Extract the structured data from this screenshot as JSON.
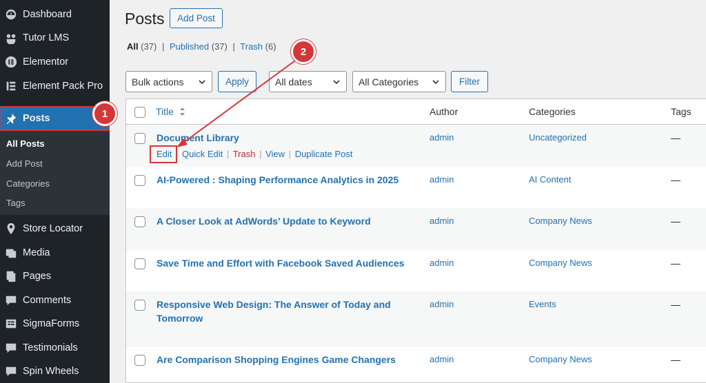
{
  "sidebar": {
    "items": [
      {
        "label": "Dashboard",
        "icon": "dashboard-icon"
      },
      {
        "label": "Tutor LMS",
        "icon": "tutor-icon"
      },
      {
        "label": "Elementor",
        "icon": "elementor-icon"
      },
      {
        "label": "Element Pack Pro",
        "icon": "element-pack-icon"
      },
      {
        "label": "Posts",
        "icon": "pin-icon"
      },
      {
        "label": "Store Locator",
        "icon": "location-pin-icon"
      },
      {
        "label": "Media",
        "icon": "media-icon"
      },
      {
        "label": "Pages",
        "icon": "pages-icon"
      },
      {
        "label": "Comments",
        "icon": "comments-icon"
      },
      {
        "label": "SigmaForms",
        "icon": "forms-icon"
      },
      {
        "label": "Testimonials",
        "icon": "testimonials-icon"
      },
      {
        "label": "Spin Wheels",
        "icon": "spin-wheel-icon"
      }
    ],
    "submenu": [
      "All Posts",
      "Add Post",
      "Categories",
      "Tags"
    ]
  },
  "annotations": {
    "step1": "1",
    "step2": "2",
    "color": "#d63638"
  },
  "header": {
    "title": "Posts",
    "add_button": "Add Post"
  },
  "filters": {
    "all": "All",
    "all_count": "(37)",
    "published": "Published",
    "published_count": "(37)",
    "trash": "Trash",
    "trash_count": "(6)",
    "separator": "|"
  },
  "toolbar": {
    "bulk_actions": "Bulk actions",
    "apply": "Apply",
    "dates": "All dates",
    "categories": "All Categories",
    "filter": "Filter"
  },
  "table": {
    "headers": {
      "title": "Title",
      "author": "Author",
      "categories": "Categories",
      "tags": "Tags"
    },
    "row_actions": {
      "edit": "Edit",
      "quick_edit": "Quick Edit",
      "trash": "Trash",
      "view": "View",
      "duplicate": "Duplicate Post",
      "sep": "|"
    },
    "rows": [
      {
        "title": "Document Library",
        "author": "admin",
        "category": "Uncategorized",
        "tags": "—"
      },
      {
        "title": "AI-Powered : Shaping Performance Analytics in 2025",
        "author": "admin",
        "category": "AI Content",
        "tags": "—"
      },
      {
        "title": "A Closer Look at AdWords’ Update to Keyword",
        "author": "admin",
        "category": "Company News",
        "tags": "—"
      },
      {
        "title": "Save Time and Effort with Facebook Saved Audiences",
        "author": "admin",
        "category": "Company News",
        "tags": "—"
      },
      {
        "title": "Responsive Web Design: The Answer of Today and Tomorrow",
        "author": "admin",
        "category": "Events",
        "tags": "—"
      },
      {
        "title": "Are Comparison Shopping Engines Game Changers",
        "author": "admin",
        "category": "Company News",
        "tags": "—"
      }
    ]
  },
  "colors": {
    "accent": "#2271b1",
    "sidebar": "#1d2327",
    "active": "#2271b1",
    "annotation": "#d63638"
  }
}
